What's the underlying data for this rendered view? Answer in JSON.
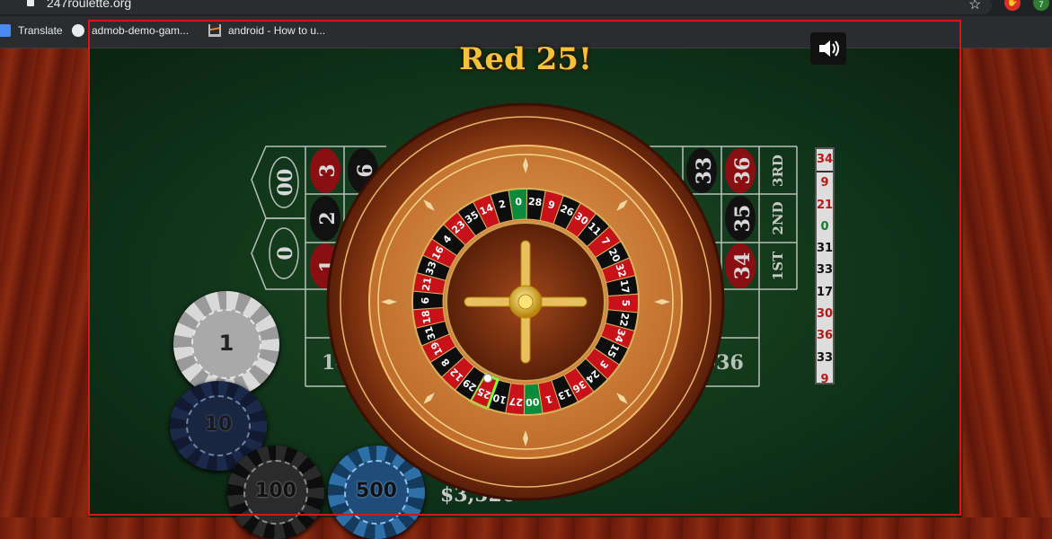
{
  "browser": {
    "url": "247roulette.org",
    "extension_badge": "7",
    "bookmarks": [
      "Translate",
      "admob-demo-gam...",
      "android - How to u..."
    ]
  },
  "game": {
    "result_text": "Red 25!",
    "balance": "$3,520",
    "winning_number": "25",
    "history": [
      {
        "n": "34",
        "c": "red"
      },
      {
        "n": "9",
        "c": "red"
      },
      {
        "n": "21",
        "c": "red"
      },
      {
        "n": "0",
        "c": "green"
      },
      {
        "n": "31",
        "c": "black"
      },
      {
        "n": "33",
        "c": "black"
      },
      {
        "n": "17",
        "c": "black"
      },
      {
        "n": "30",
        "c": "red"
      },
      {
        "n": "36",
        "c": "red"
      },
      {
        "n": "33",
        "c": "black"
      },
      {
        "n": "9",
        "c": "red"
      }
    ],
    "table_left": {
      "zeros": [
        "00",
        "0"
      ],
      "col_numbers": [
        [
          "3",
          "6"
        ],
        [
          "2"
        ],
        [
          "1"
        ]
      ],
      "dozen_label": "1-"
    },
    "table_right": {
      "top": [
        "33",
        "36"
      ],
      "mid": [
        "35"
      ],
      "bot": [
        "34"
      ],
      "columns": [
        "3RD",
        "2ND",
        "1ST"
      ],
      "dozen_label": "-36"
    },
    "chips": [
      "1",
      "10",
      "100",
      "500"
    ],
    "wheel_numbers": [
      "0",
      "28",
      "9",
      "26",
      "30",
      "11",
      "7",
      "20",
      "32",
      "17",
      "5",
      "22",
      "34",
      "15",
      "3",
      "24",
      "36",
      "13",
      "1",
      "00",
      "27",
      "10",
      "25",
      "29",
      "12",
      "8",
      "19",
      "31",
      "18",
      "6",
      "21",
      "33",
      "16",
      "4",
      "23",
      "35",
      "14",
      "2"
    ],
    "colors": {
      "red": "#c8121a",
      "black": "#0d0d0d",
      "green": "#0b8a3c",
      "gold": "#f6c13a"
    }
  }
}
